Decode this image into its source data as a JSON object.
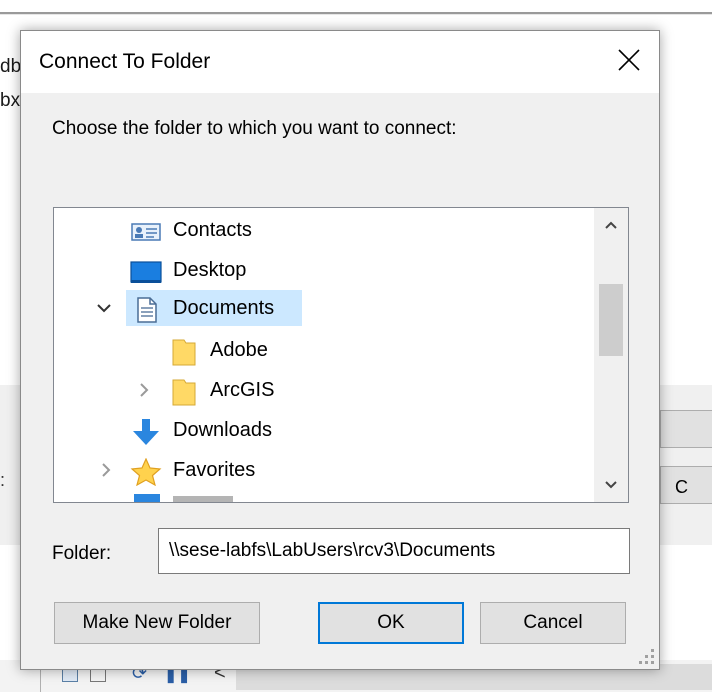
{
  "background": {
    "left_texts": [
      "db",
      "bx"
    ],
    "right_button_label": "C",
    "left_glyph": ":"
  },
  "dialog": {
    "title": "Connect To Folder",
    "instruction": "Choose the folder to which you want to connect:",
    "tree": {
      "items": [
        {
          "label": "Contacts",
          "icon": "contacts-icon",
          "expander": "none",
          "level": 1
        },
        {
          "label": "Desktop",
          "icon": "desktop-icon",
          "expander": "none",
          "level": 1
        },
        {
          "label": "Documents",
          "icon": "documents-icon",
          "expander": "expanded",
          "level": 1,
          "selected": true
        },
        {
          "label": "Adobe",
          "icon": "folder-icon",
          "expander": "none",
          "level": 2
        },
        {
          "label": "ArcGIS",
          "icon": "folder-icon",
          "expander": "collapsed",
          "level": 2
        },
        {
          "label": "Downloads",
          "icon": "downloads-icon",
          "expander": "none",
          "level": 1
        },
        {
          "label": "Favorites",
          "icon": "favorites-icon",
          "expander": "collapsed",
          "level": 1
        }
      ]
    },
    "folder_label": "Folder:",
    "folder_value": "\\\\sese-labfs\\LabUsers\\rcv3\\Documents",
    "buttons": {
      "make_new_folder": "Make New Folder",
      "ok": "OK",
      "cancel": "Cancel"
    }
  },
  "colors": {
    "selection": "#cce8ff",
    "default_button_border": "#0078d7",
    "folder_yellow": "#ffd966"
  }
}
